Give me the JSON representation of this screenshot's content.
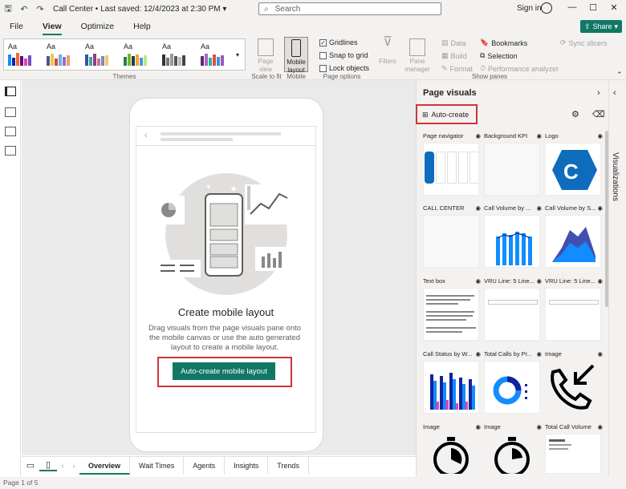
{
  "titlebar": {
    "title": "Call Center • Last saved: 12/4/2023 at 2:30 PM ▾",
    "search_placeholder": "Search",
    "signin": "Sign in"
  },
  "tabs": [
    "File",
    "View",
    "Optimize",
    "Help"
  ],
  "share_label": "Share",
  "ribbon": {
    "themes_label": "Themes",
    "scale_label": "Scale to fit",
    "mobile_label": "Mobile",
    "page_options_label": "Page options",
    "show_panes_label": "Show panes",
    "page_view": "Page view",
    "mobile_layout": "Mobile layout",
    "gridlines": "Gridlines",
    "snap_to_grid": "Snap to grid",
    "lock_objects": "Lock objects",
    "filters": "Filters",
    "pane_manager": "Pane manager",
    "data": "Data",
    "build": "Build",
    "format": "Format",
    "bookmarks": "Bookmarks",
    "selection": "Selection",
    "performance_analyzer": "Performance analyzer",
    "sync_slicers": "Sync slicers"
  },
  "mobile_canvas": {
    "title": "Create mobile layout",
    "description": "Drag visuals from the page visuals pane onto the mobile canvas or use the auto generated layout to create a mobile layout.",
    "button": "Auto-create mobile layout"
  },
  "page_tabs": [
    "Overview",
    "Wait Times",
    "Agents",
    "Insights",
    "Trends"
  ],
  "status": "Page 1 of 5",
  "pane": {
    "title": "Page visuals",
    "auto_create": "Auto-create",
    "visualizations_label": "Visualizations",
    "cards": [
      {
        "title": "Page navigator"
      },
      {
        "title": "Background KPI"
      },
      {
        "title": "Logo"
      },
      {
        "title": "CALL CENTER"
      },
      {
        "title": "Call Volume by ..."
      },
      {
        "title": "Call Volume by S..."
      },
      {
        "title": "Text box"
      },
      {
        "title": "VRU Line: 5 Line..."
      },
      {
        "title": "VRU Line: 5 Line..."
      },
      {
        "title": "Call Status by W..."
      },
      {
        "title": "Total Calls by Pr..."
      },
      {
        "title": "Image"
      },
      {
        "title": "Image"
      },
      {
        "title": "Image"
      },
      {
        "title": "Total Call Volume"
      }
    ]
  },
  "colors": {
    "accent": "#117865",
    "highlight": "#d13438",
    "blue": "#0f6cbd"
  }
}
